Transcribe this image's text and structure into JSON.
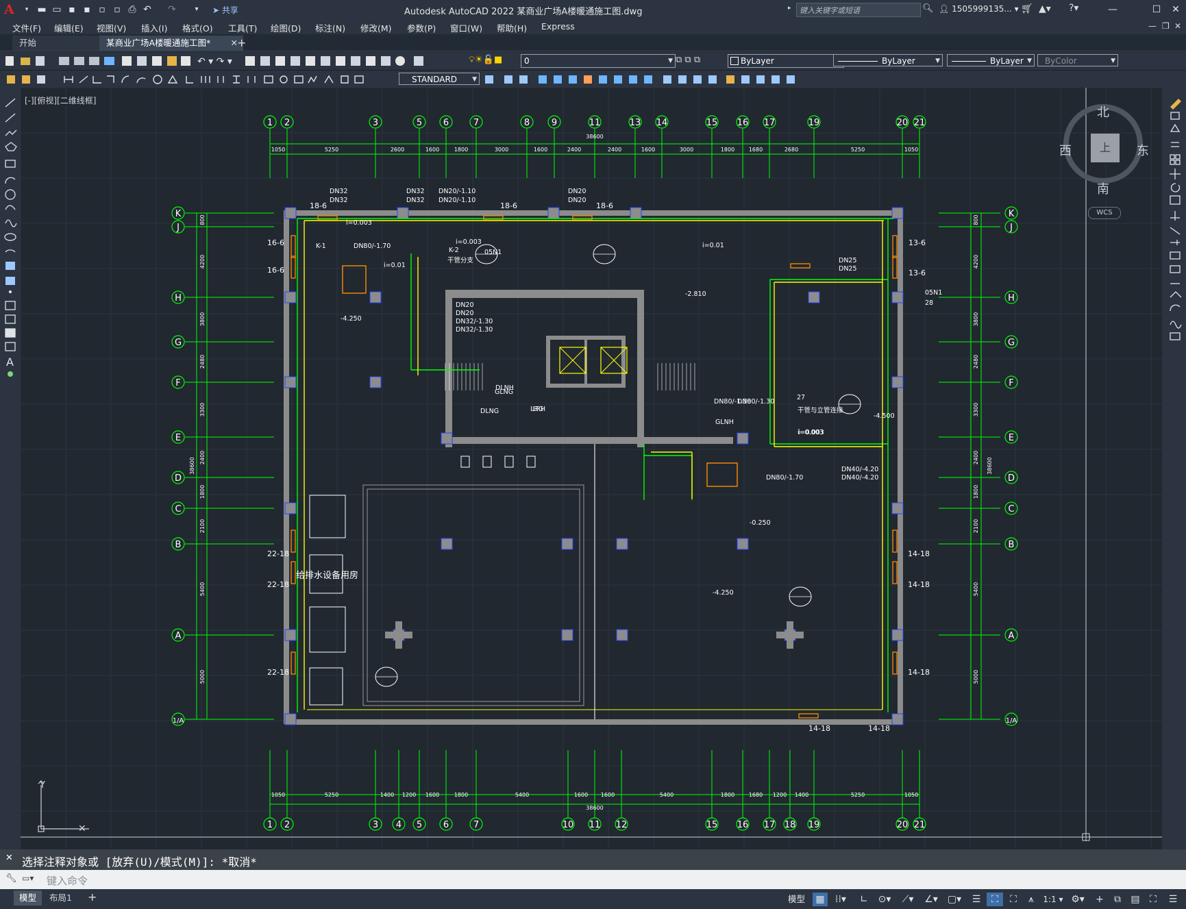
{
  "titlebar": {
    "app_title": "Autodesk AutoCAD 2022    某商业广场A楼暖通施工图.dwg",
    "share_label": "共享",
    "search_placeholder": "键入关键字或短语",
    "user": "1505999135..."
  },
  "menubar": [
    "文件(F)",
    "编辑(E)",
    "视图(V)",
    "插入(I)",
    "格式(O)",
    "工具(T)",
    "绘图(D)",
    "标注(N)",
    "修改(M)",
    "参数(P)",
    "窗口(W)",
    "帮助(H)",
    "Express"
  ],
  "tabs": {
    "start": "开始",
    "document": "某商业广场A楼暖通施工图*"
  },
  "properties": {
    "layer": "0",
    "color": "ByLayer",
    "linetype": "ByLayer",
    "lineweight": "ByLayer",
    "plotstyle": "ByColor",
    "textstyle": "STANDARD"
  },
  "viewport_label": "[-][俯视][二维线框]",
  "viewcube": {
    "north": "北",
    "south": "南",
    "west": "西",
    "east": "东",
    "top": "上",
    "wcs": "WCS"
  },
  "drawing": {
    "grid_top": [
      "1",
      "2",
      "3",
      "5",
      "6",
      "7",
      "8",
      "9",
      "11",
      "13",
      "14",
      "15",
      "16",
      "17",
      "19",
      "20",
      "21"
    ],
    "grid_bottom": [
      "1",
      "2",
      "3",
      "4",
      "5",
      "6",
      "7",
      "10",
      "11",
      "12",
      "15",
      "16",
      "17",
      "18",
      "19",
      "20",
      "21"
    ],
    "grid_left": [
      "K",
      "J",
      "H",
      "G",
      "F",
      "E",
      "D",
      "C",
      "B",
      "A",
      "1/A"
    ],
    "dims_top": [
      "1050",
      "5250",
      "2600",
      "1600",
      "1800",
      "3000",
      "1600",
      "2400",
      "2400",
      "1600",
      "3000",
      "1800",
      "1680",
      "2680",
      "5250",
      "1050"
    ],
    "total_top": "38600",
    "dims_bottom": [
      "1050",
      "5250",
      "1400",
      "1200",
      "1600",
      "1800",
      "5400",
      "1600",
      "1600",
      "5400",
      "1800",
      "1680",
      "1200",
      "1400",
      "5250",
      "1050"
    ],
    "total_bottom": "38600",
    "dims_left": [
      "800",
      "4200",
      "3800",
      "2480",
      "3300",
      "2400",
      "1800",
      "2100",
      "5400",
      "5000"
    ],
    "total_left": "38600",
    "room_label": "给排水设备用房",
    "labels": [
      "DN32",
      "DN32",
      "DN32",
      "DN32",
      "DN20/-1.10",
      "DN20/-1.10",
      "DN20",
      "DN20",
      "18-6",
      "18-6",
      "18-6",
      "16-6",
      "16-6",
      "13-6",
      "13-6",
      "22-18",
      "22-18",
      "22-18",
      "14-18",
      "14-18",
      "14-18",
      "14-18",
      "14-18",
      "i=0.003",
      "i=0.003",
      "i=0.01",
      "i=0.01",
      "i=0.003",
      "i=0.003",
      "K-1",
      "DN80/-1.70",
      "DN80/-1.70",
      "K-2",
      "干管分支",
      "05N1",
      "27",
      "干管与立管连接",
      "05N1",
      "28",
      "-2.810",
      "-4.250",
      "-4.500",
      "-4.250",
      "-0.250",
      "DN40/-4.20",
      "DN40/-4.20",
      "DN25",
      "DN25",
      "DN20",
      "DN20",
      "DN32/-1.30",
      "DN32/-1.30",
      "DN80/-1.30",
      "DN80/-1.30",
      "DLNG",
      "DLNH",
      "GLNH",
      "GLNG",
      "LRG",
      "LRH"
    ]
  },
  "command": {
    "history": "选择注释对象或 [放弃(U)/模式(M)]: *取消*",
    "placeholder": "键入命令"
  },
  "statusbar": {
    "model_tab": "模型",
    "layout_tab": "布局1",
    "model_button": "模型",
    "scale": "1:1"
  },
  "colors": {
    "grid": "#00ff00",
    "wall": "#8c8c8c",
    "pipe_yellow": "#ffff00",
    "pipe_orange": "#ff8c00",
    "column_outline": "#2244ff",
    "bg": "#212830"
  }
}
